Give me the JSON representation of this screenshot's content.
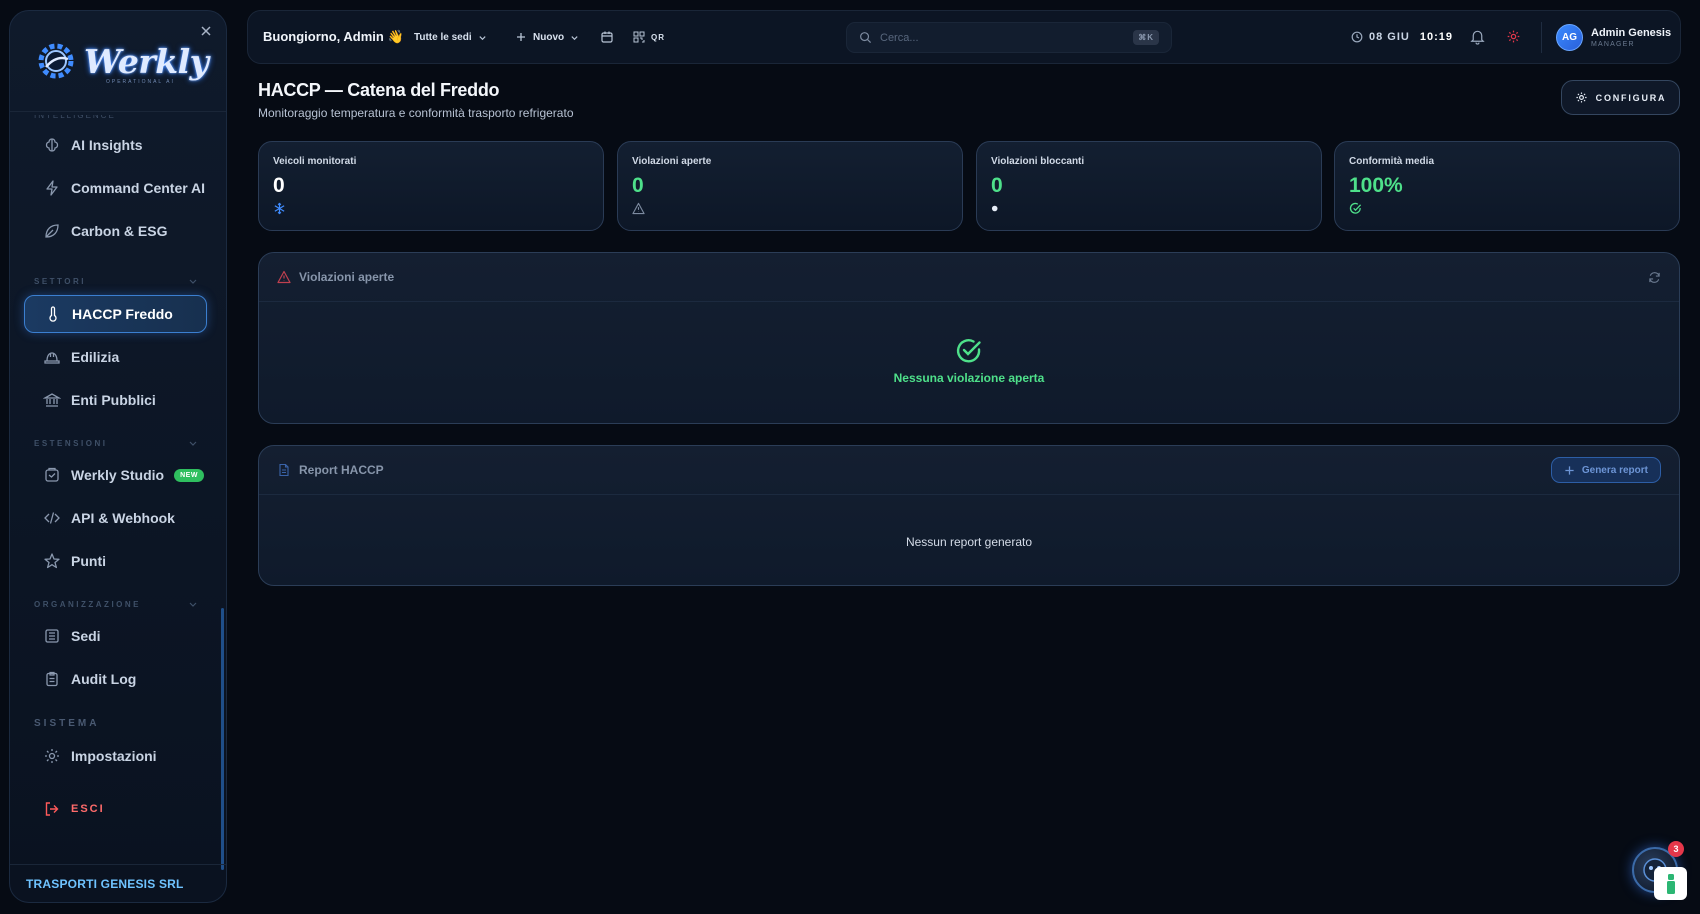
{
  "sidebar": {
    "logo_text": "Werkly",
    "logo_subtitle": "OPERATIONAL AI",
    "cut_label": "INTELLIGENCE",
    "items": [
      {
        "label": "AI Insights",
        "icon": "brain-icon"
      },
      {
        "label": "Command Center AI",
        "icon": "bolt-icon"
      },
      {
        "label": "Carbon & ESG",
        "icon": "leaf-icon"
      },
      {
        "label": "HACCP Freddo",
        "icon": "thermometer-icon",
        "active": true
      },
      {
        "label": "Edilizia",
        "icon": "hardhat-icon"
      },
      {
        "label": "Enti Pubblici",
        "icon": "landmark-icon"
      },
      {
        "label": "Werkly Studio",
        "icon": "studio-icon",
        "badge": "NEW"
      },
      {
        "label": "API & Webhook",
        "icon": "code-icon"
      },
      {
        "label": "Punti",
        "icon": "star-icon"
      },
      {
        "label": "Sedi",
        "icon": "building-icon"
      },
      {
        "label": "Audit Log",
        "icon": "clipboard-icon"
      },
      {
        "label": "Impostazioni",
        "icon": "gear-icon"
      },
      {
        "label": "ESCI",
        "icon": "logout-icon"
      }
    ],
    "sections": {
      "settori": "SETTORI",
      "estensioni": "ESTENSIONI",
      "organizzazione": "ORGANIZZAZIONE",
      "sistema": "SISTEMA"
    },
    "footer": "TRASPORTI GENESIS SRL"
  },
  "topbar": {
    "greeting": "Buongiorno, Admin 👋",
    "location_select": "Tutte le sedi",
    "new_label": "Nuovo",
    "qr_label": "QR",
    "search_placeholder": "Cerca...",
    "search_shortcut": "⌘K",
    "date": "08 GIU",
    "time": "10:19",
    "user_initials": "AG",
    "user_name": "Admin Genesis",
    "user_role": "MANAGER"
  },
  "page": {
    "title": "HACCP — Catena del Freddo",
    "subtitle": "Monitoraggio temperatura e conformità trasporto refrigerato",
    "config_label": "CONFIGURA"
  },
  "stats": [
    {
      "label": "Veicoli monitorati",
      "value": "0",
      "icon": "snowflake-icon"
    },
    {
      "label": "Violazioni aperte",
      "value": "0",
      "icon": "warning-icon"
    },
    {
      "label": "Violazioni bloccanti",
      "value": "0",
      "icon": "dot-icon"
    },
    {
      "label": "Conformità media",
      "value": "100%",
      "icon": "check-circle-icon"
    }
  ],
  "violations_panel": {
    "title": "Violazioni aperte",
    "empty_text": "Nessuna violazione aperta"
  },
  "report_panel": {
    "title": "Report HACCP",
    "generate_label": "Genera report",
    "empty_text": "Nessun report generato"
  },
  "fab": {
    "badge_count": "3"
  },
  "colors": {
    "accent": "#3b7fd0",
    "success": "#4ee08a",
    "danger": "#ff5a5a",
    "background": "#060b14"
  }
}
